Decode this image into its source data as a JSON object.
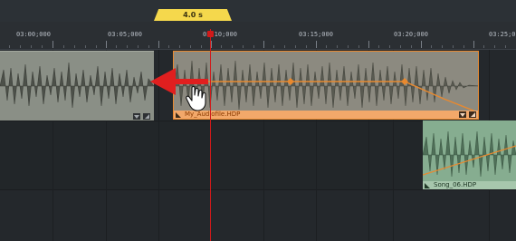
{
  "window": {
    "segment_length": "4.0 s"
  },
  "ruler": {
    "labels": [
      "03:00;000",
      "03:05;000",
      "03:10;000",
      "03:15;000",
      "03:20;000",
      "03:25;000"
    ]
  },
  "clips": [
    {
      "name": "",
      "selected": false,
      "color": "#8a8f86"
    },
    {
      "name": "My_Audiofile.HDP",
      "selected": true,
      "color": "#8c8a80",
      "border": "#e8892f"
    },
    {
      "name": "Song_06.HDP",
      "selected": false,
      "color": "#86ad90"
    }
  ],
  "colors": {
    "accent": "#e8892f",
    "playhead": "#d11a1a",
    "drag_arrow": "#e01f1f",
    "length_badge": "#f5d84c"
  },
  "icons": {
    "drag_cursor": "hand-cursor-icon",
    "drag_direction": "left-arrow-icon",
    "envelope_point": "keyframe-diamond-icon"
  }
}
